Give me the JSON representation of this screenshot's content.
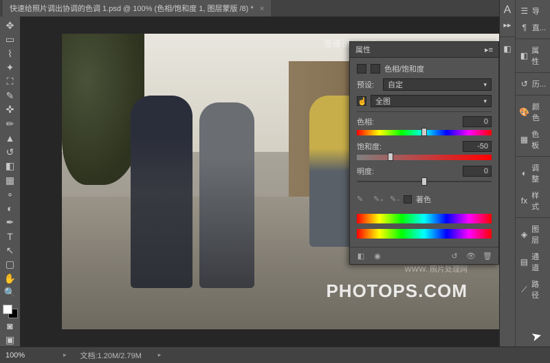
{
  "tab": {
    "title": "快速给照片调出协调的色调 1.psd @ 100% (色相/饱和度 1, 图层蒙版 /8) *"
  },
  "watermarks": {
    "top": "思缘设计论坛  WWW.MISSYUAN.COM",
    "mid": "WWW. 照片处理网",
    "big": "PHOTOPS.COM"
  },
  "panel": {
    "tab": "属性",
    "title": "色相/饱和度",
    "preset_lbl": "预设:",
    "preset_val": "自定",
    "range_val": "全图",
    "hue_lbl": "色相:",
    "hue_val": "0",
    "sat_lbl": "饱和度:",
    "sat_val": "-50",
    "light_lbl": "明度:",
    "light_val": "0",
    "colorize": "著色"
  },
  "dock": {
    "char": "导",
    "para": "直...",
    "props": "属性",
    "history": "历...",
    "color": "颜色",
    "swatch": "色板",
    "adjust": "调整",
    "styles": "样式",
    "layers": "图层",
    "channels": "通道",
    "paths": "路径"
  },
  "status": {
    "zoom": "100%",
    "doc": "文档:1.20M/2.79M"
  }
}
